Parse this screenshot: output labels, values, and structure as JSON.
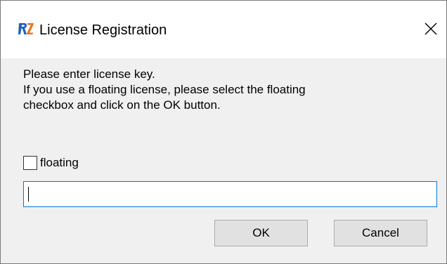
{
  "window": {
    "title": "License Registration",
    "app_icon": "rz-logo-icon",
    "close_icon": "close-icon"
  },
  "message": {
    "line1": "Please enter license key.",
    "line2": "If you use a floating license, please select the floating",
    "line3": "checkbox and click on the OK button."
  },
  "floating_checkbox": {
    "label": "floating",
    "checked": false
  },
  "license_key_input": {
    "value": "",
    "placeholder": ""
  },
  "buttons": {
    "ok_label": "OK",
    "cancel_label": "Cancel"
  },
  "colors": {
    "logo_blue": "#1f5fbf",
    "logo_orange": "#e8741c",
    "input_focus_border": "#0078d7",
    "dialog_background": "#f0f0f0",
    "button_face": "#e1e1e1"
  }
}
